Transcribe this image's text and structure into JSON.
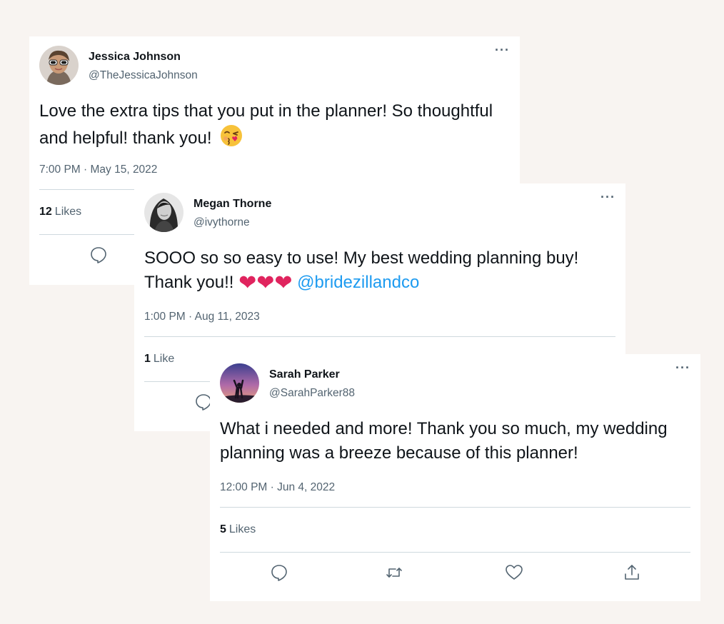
{
  "tweets": [
    {
      "name": "Jessica Johnson",
      "handle": "@TheJessicaJohnson",
      "more_label": "···",
      "text": "Love the extra tips that you put in the planner! So thoughtful and helpful! thank you!",
      "emoji": "face-blowing-a-kiss",
      "timestamp": "7:00 PM · May 15, 2022",
      "likes_count": "12",
      "likes_label": "Likes",
      "icons": [
        "reply-icon"
      ]
    },
    {
      "name": "Megan Thorne",
      "handle": "@ivythorne",
      "more_label": "···",
      "text": "SOOO so so easy to use! My best wedding planning buy! Thank you!!",
      "hearts": "❤❤❤",
      "mention": "@bridezillandco",
      "timestamp": "1:00 PM · Aug 11, 2023",
      "likes_count": "1",
      "likes_label": "Like",
      "icons": [
        "reply-icon"
      ]
    },
    {
      "name": "Sarah Parker",
      "handle": "@SarahParker88",
      "more_label": "···",
      "text": "What i needed and more! Thank you so much, my wedding planning was a breeze because of this planner!",
      "timestamp": "12:00 PM · Jun 4, 2022",
      "likes_count": "5",
      "likes_label": "Likes",
      "icons": [
        "reply-icon",
        "retweet-icon",
        "like-icon",
        "share-icon"
      ]
    }
  ],
  "colors": {
    "background": "#f8f4f1",
    "card": "#ffffff",
    "text_primary": "#0f1419",
    "text_secondary": "#536471",
    "divider": "#cfd9de",
    "mention": "#1d9bf0",
    "heart": "#e0245e"
  }
}
